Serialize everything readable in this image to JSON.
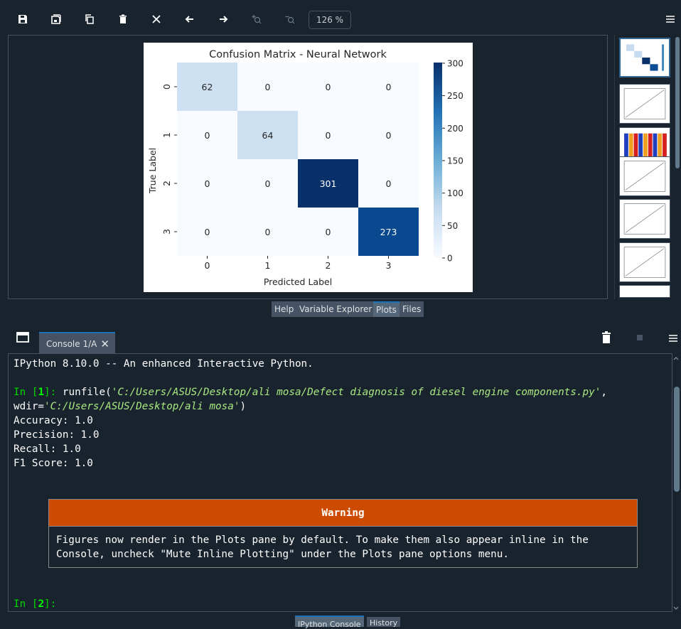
{
  "toolbar": {
    "zoom_level": "126 %",
    "buttons": [
      "save-icon",
      "save-all-icon",
      "copy-icon",
      "delete-icon",
      "delete-all-icon",
      "previous-arrow-icon",
      "next-arrow-icon",
      "zoom-in-icon",
      "zoom-out-icon"
    ]
  },
  "plots_tabs": [
    "Help",
    "Variable Explorer",
    "Plots",
    "Files"
  ],
  "console": {
    "tab_label": "Console 1/A",
    "close_glyph": "✕",
    "banner": "IPython 8.10.0 -- An enhanced Interactive Python.",
    "in1_prompt": "In [",
    "in1_num": "1",
    "in1_close": "]:",
    "run_cmd": " runfile(",
    "run_path": "'C:/Users/ASUS/Desktop/ali mosa/Defect diagnosis of diesel engine components.py'",
    "run_sep": ",",
    "wdir_label": "wdir=",
    "wdir_path": "'C:/Users/ASUS/Desktop/ali mosa'",
    "run_end": ")",
    "outputs": [
      "Accuracy: 1.0",
      "Precision: 1.0",
      "Recall: 1.0",
      "F1 Score: 1.0"
    ],
    "warning_title": "Warning",
    "warning_text": "Figures now render in the Plots pane by default. To make them also appear inline in the\nConsole, uncheck \"Mute Inline Plotting\" under the Plots pane options menu.",
    "in2_prompt": "In [",
    "in2_num": "2",
    "in2_close": "]:"
  },
  "console_tabs": [
    "IPython Console",
    "History"
  ],
  "colors": {
    "background": "#19232d",
    "accent": "#1a72bb",
    "warning": "#cc4b00",
    "prompt": "#00ff00",
    "string": "#a9e882"
  },
  "chart_data": {
    "type": "heatmap",
    "title": "Confusion Matrix - Neural Network",
    "xlabel": "Predicted Label",
    "ylabel": "True Label",
    "x_categories": [
      "0",
      "1",
      "2",
      "3"
    ],
    "y_categories": [
      "0",
      "1",
      "2",
      "3"
    ],
    "values": [
      [
        62,
        0,
        0,
        0
      ],
      [
        0,
        64,
        0,
        0
      ],
      [
        0,
        0,
        301,
        0
      ],
      [
        0,
        0,
        0,
        273
      ]
    ],
    "colormap": "Blues",
    "colorbar_ticks": [
      0,
      50,
      100,
      150,
      200,
      250,
      300
    ],
    "colorbar_range": [
      0,
      301
    ]
  }
}
